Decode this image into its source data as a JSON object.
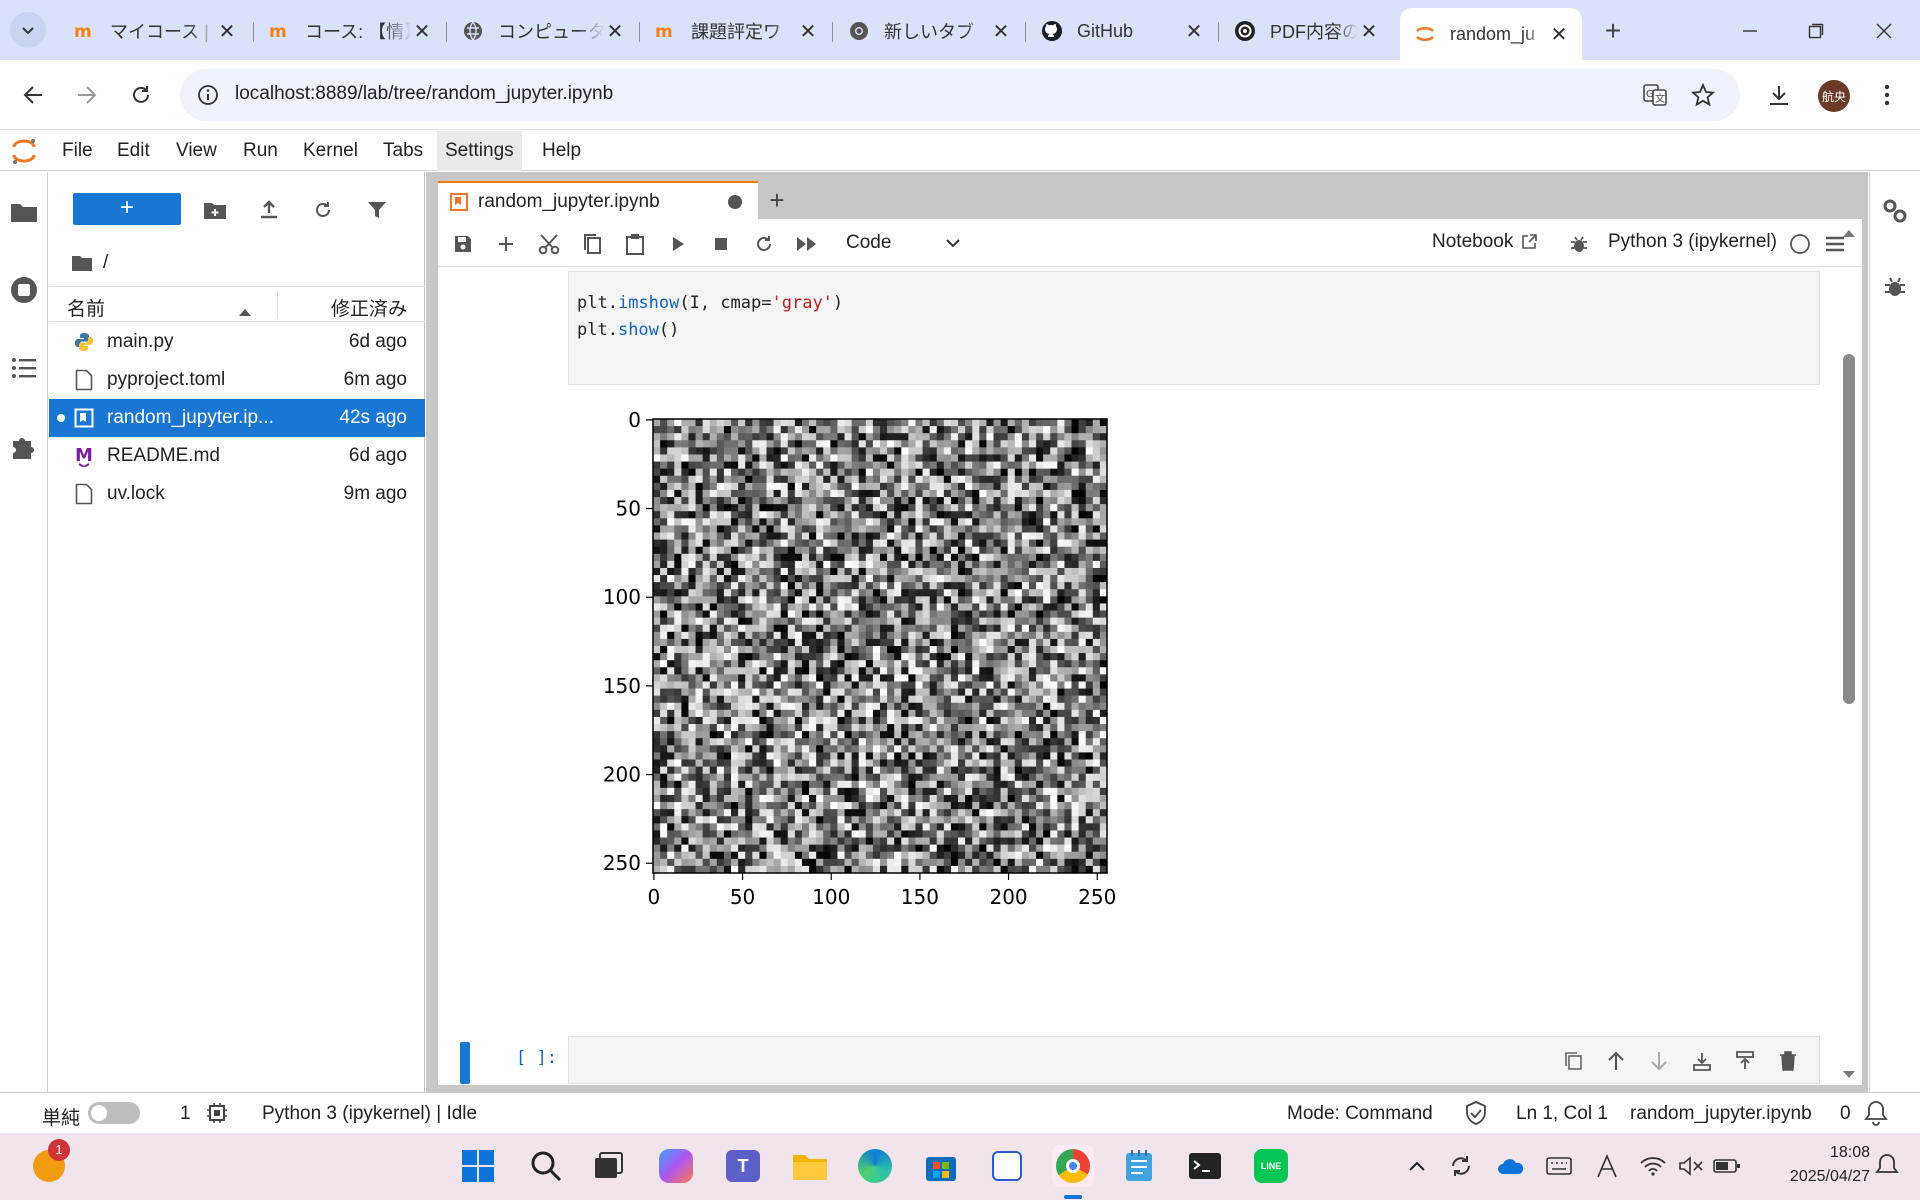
{
  "browser": {
    "tabs": [
      {
        "title": "マイコース | S",
        "icon": "moodle-icon"
      },
      {
        "title": "コース: 【情】",
        "icon": "moodle-icon"
      },
      {
        "title": "コンピュータビ",
        "icon": "globe-icon"
      },
      {
        "title": "課題評定ワ",
        "icon": "moodle-icon"
      },
      {
        "title": "新しいタブ",
        "icon": "chrome-icon"
      },
      {
        "title": "GitHub",
        "icon": "github-icon"
      },
      {
        "title": "PDF内容の",
        "icon": "openai-icon"
      },
      {
        "title": "random_ju",
        "icon": "jupyter-icon"
      }
    ],
    "url": "localhost:8889/lab/tree/random_jupyter.ipynb",
    "profile_initials": "航央"
  },
  "jupyter": {
    "menu": [
      "File",
      "Edit",
      "View",
      "Run",
      "Kernel",
      "Tabs",
      "Settings",
      "Help"
    ],
    "filebrowser": {
      "new_label": "+",
      "path": "/",
      "col_name": "名前",
      "col_modified": "修正済み",
      "files": [
        {
          "name": "main.py",
          "modified": "6d ago",
          "icon": "python-file-icon"
        },
        {
          "name": "pyproject.toml",
          "modified": "6m ago",
          "icon": "file-icon"
        },
        {
          "name": "random_jupyter.ip...",
          "modified": "42s ago",
          "icon": "notebook-icon",
          "selected": true
        },
        {
          "name": "README.md",
          "modified": "6d ago",
          "icon": "markdown-icon"
        },
        {
          "name": "uv.lock",
          "modified": "9m ago",
          "icon": "file-icon"
        }
      ]
    },
    "notebook": {
      "tab_title": "random_jupyter.ipynb",
      "cell_type": "Code",
      "notebook_label": "Notebook",
      "kernel": "Python 3 (ipykernel)",
      "code": {
        "line1_a": "plt.",
        "line1_fn": "imshow",
        "line1_b": "(I, cmap=",
        "line1_str": "'gray'",
        "line1_c": ")",
        "line2_a": "plt.",
        "line2_fn": "show",
        "line2_b": "()"
      },
      "empty_prompt": "[ ]:"
    },
    "status": {
      "mode_simple": "単純",
      "terminals": "1",
      "kernel_status": "Python 3 (ipykernel) | Idle",
      "mode": "Mode: Command",
      "position": "Ln 1, Col 1",
      "filename": "random_jupyter.ipynb",
      "notifications": "0"
    }
  },
  "chart_data": {
    "type": "heatmap",
    "description_values": "random grayscale noise image 256x256",
    "xticks": [
      "0",
      "50",
      "100",
      "150",
      "200",
      "250"
    ],
    "yticks": [
      "0",
      "50",
      "100",
      "150",
      "200",
      "250"
    ],
    "xlim": [
      0,
      256
    ],
    "ylim": [
      256,
      0
    ],
    "colormap": "gray"
  },
  "taskbar": {
    "time": "18:08",
    "date": "2025/04/27",
    "notification_count": "1"
  }
}
